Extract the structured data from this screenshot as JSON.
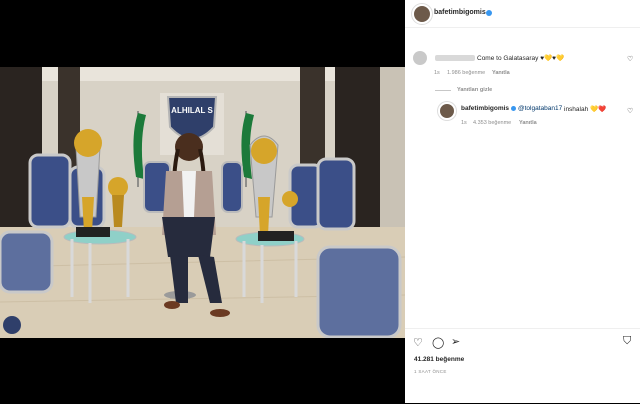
{
  "post": {
    "username": "bafetimbigomis",
    "more_icon": "more-horizontal-icon"
  },
  "comments": [
    {
      "text": "Come to Galatasaray ♥💛♥💛",
      "age": "1s",
      "likes": "1.986 beğenme",
      "reply": "Yanıtla",
      "hide_replies": "Yanıtları gizle"
    }
  ],
  "reply": {
    "username": "bafetimbigomis",
    "mention": "@tolgataban17",
    "text": " inshalah 💛❤️",
    "age": "1s",
    "likes": "4.353 beğenme",
    "reply": "Yanıtla"
  },
  "actions": {
    "likes": "41.281 beğenme",
    "time": "1 SAAT ÖNCE"
  },
  "photo": {
    "emblem_text": "ALHILAL S"
  }
}
